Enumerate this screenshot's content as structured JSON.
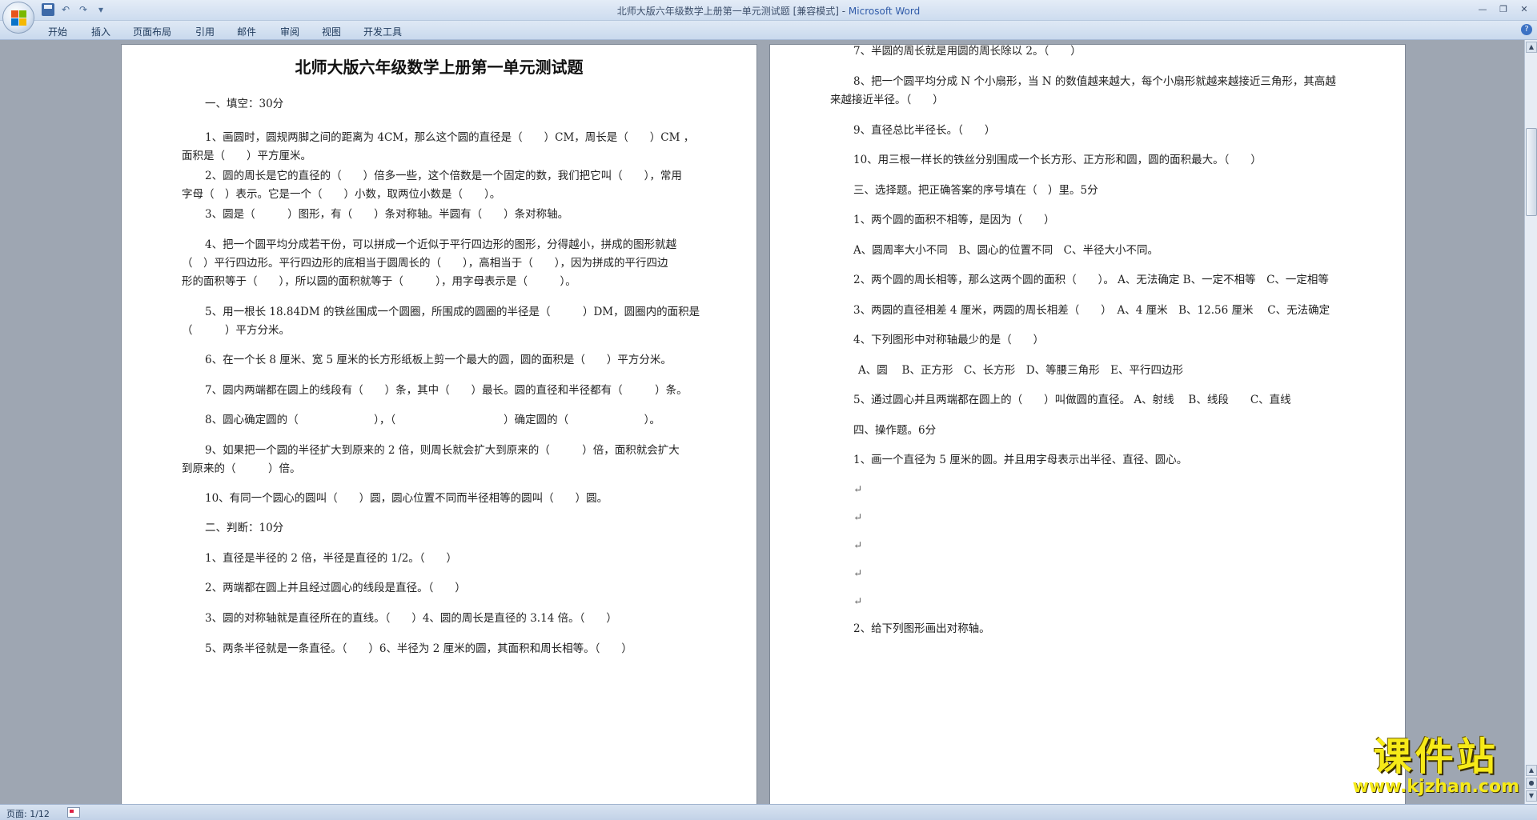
{
  "window": {
    "title": "北师大版六年级数学上册第一单元测试题 [兼容模式] - ",
    "app_name": "Microsoft Word"
  },
  "ribbon": {
    "tabs": [
      "开始",
      "插入",
      "页面布局",
      "引用",
      "邮件",
      "审阅",
      "视图",
      "开发工具"
    ]
  },
  "status": {
    "page_info": "页面: 1/12"
  },
  "watermark": {
    "text": "课件站",
    "url": "www.kjzhan.com"
  },
  "document": {
    "title": "北师大版六年级数学上册第一单元测试题",
    "page1": [
      "一、填空：30分",
      "1、画圆时，圆规两脚之间的距离为 4CM，那么这个圆的直径是（　　）CM，周长是（　　）CM ，",
      "面积是（　　）平方厘米。",
      "2、圆的周长是它的直径的（　　）倍多一些，这个倍数是一个固定的数，我们把它叫（　　），常用",
      "字母（　）表示。它是一个（　　）小数，取两位小数是（　　）。",
      "3、圆是（　　　）图形，有（　　）条对称轴。半圆有（　　）条对称轴。",
      "4、把一个圆平均分成若干份，可以拼成一个近似于平行四边形的图形，分得越小，拼成的图形就越",
      "（　）平行四边形。平行四边形的底相当于圆周长的（　　），高相当于（　　），因为拼成的平行四边",
      "形的面积等于（　　），所以圆的面积就等于（　　　），用字母表示是（　　　）。",
      "5、用一根长 18.84DM 的铁丝围成一个圆圈，所围成的圆圈的半径是（　　　）DM，圆圈内的面积是",
      "（　　　）平方分米。",
      "6、在一个长 8 厘米、宽 5 厘米的长方形纸板上剪一个最大的圆，圆的面积是（　　）平方分米。",
      "7、圆内两端都在圆上的线段有（　　）条，其中（　　）最长。圆的直径和半径都有（　　　）条。",
      "8、圆心确定圆的（　　　　　　　），（　　　　　　　　　　）确定圆的（　　　　　　　）。",
      "9、如果把一个圆的半径扩大到原来的 2 倍，则周长就会扩大到原来的（　　　）倍，面积就会扩大",
      "到原来的（　　　）倍。",
      "10、有同一个圆心的圆叫（　　）圆，圆心位置不同而半径相等的圆叫（　　）圆。",
      "二、判断：10分",
      "1、直径是半径的 2 倍，半径是直径的 1/2。（　　）",
      "2、两端都在圆上并且经过圆心的线段是直径。（　　）",
      "3、圆的对称轴就是直径所在的直线。（　　）4、圆的周长是直径的 3.14 倍。（　　）",
      "5、两条半径就是一条直径。（　　）6、半径为 2 厘米的圆，其面积和周长相等。（　　）"
    ],
    "page2": [
      "7、半圆的周长就是用圆的周长除以 2。（　　）",
      "8、把一个圆平均分成 N 个小扇形，当 N 的数值越来越大，每个小扇形就越来越接近三角形，其高越",
      "来越接近半径。（　　）",
      "9、直径总比半径长。（　　）",
      "10、用三根一样长的铁丝分别围成一个长方形、正方形和圆，圆的面积最大。（　　）",
      "三、选择题。把正确答案的序号填在（　）里。5分",
      "1、两个圆的面积不相等，是因为（　　）",
      "A、圆周率大小不同　B、圆心的位置不同　C、半径大小不同。",
      "2、两个圆的周长相等，那么这两个圆的面积（　　）。 A、无法确定 B、一定不相等　C、一定相等",
      "3、两圆的直径相差 4 厘米，两圆的周长相差（　　）　A、4 厘米　B、12.56 厘米　 C、无法确定",
      "4、下列图形中对称轴最少的是（　　）",
      "A、圆　 B、正方形　C、长方形　D、等腰三角形　E、平行四边形",
      "5、通过圆心并且两端都在圆上的（　　）叫做圆的直径。 A、射线　 B、线段　　C、直线",
      "四、操作题。6分",
      "1、画一个直径为 5 厘米的圆。并且用字母表示出半径、直径、圆心。",
      "",
      "",
      "",
      "",
      "",
      "2、给下列图形画出对称轴。"
    ]
  }
}
